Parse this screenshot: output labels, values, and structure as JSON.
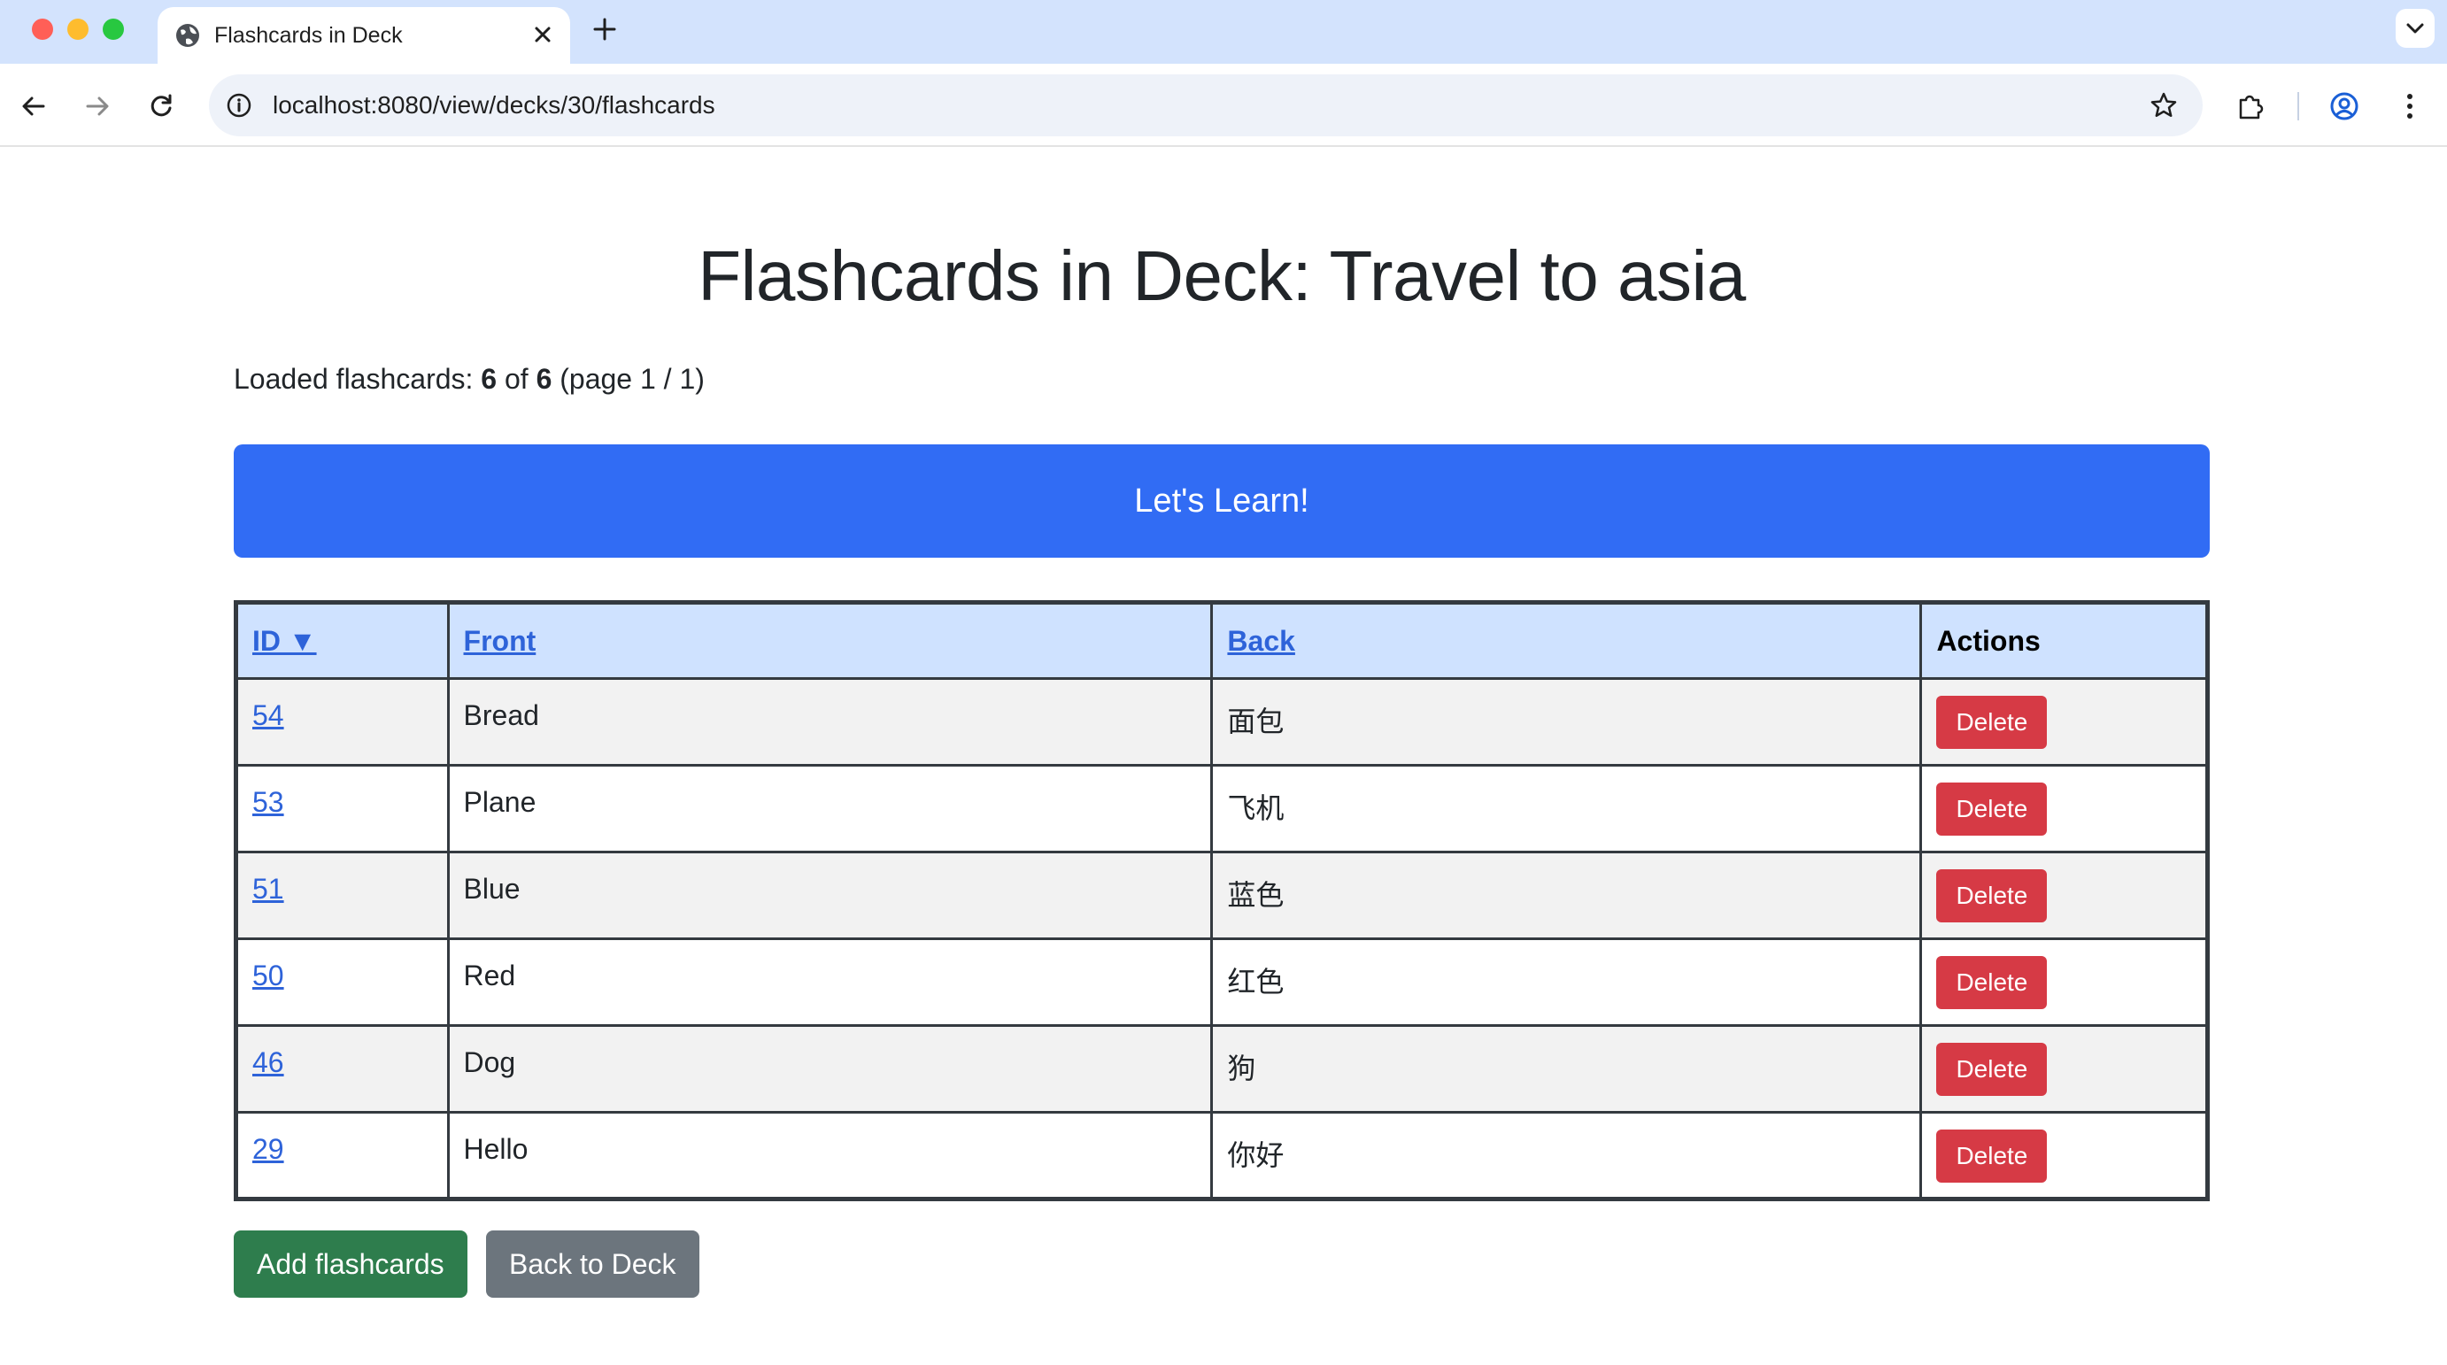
{
  "browser": {
    "tab_title": "Flashcards in Deck",
    "url": "localhost:8080/view/decks/30/flashcards"
  },
  "page": {
    "title": "Flashcards in Deck: Travel to asia",
    "loaded": {
      "prefix": "Loaded flashcards: ",
      "count": "6",
      "of_label": " of ",
      "total": "6",
      "page_info": " (page 1 / 1)"
    },
    "learn_button": "Let's Learn!",
    "table": {
      "headers": {
        "id": "ID ▼",
        "front": "Front",
        "back": "Back",
        "actions": "Actions"
      },
      "rows": [
        {
          "id": "54",
          "front": "Bread",
          "back": "面包",
          "action": "Delete"
        },
        {
          "id": "53",
          "front": "Plane",
          "back": "飞机",
          "action": "Delete"
        },
        {
          "id": "51",
          "front": "Blue",
          "back": "蓝色",
          "action": "Delete"
        },
        {
          "id": "50",
          "front": "Red",
          "back": "红色",
          "action": "Delete"
        },
        {
          "id": "46",
          "front": "Dog",
          "back": "狗",
          "action": "Delete"
        },
        {
          "id": "29",
          "front": "Hello",
          "back": "你好",
          "action": "Delete"
        }
      ]
    },
    "add_button": "Add flashcards",
    "back_button": "Back to Deck"
  },
  "colors": {
    "primary": "#316cf4",
    "danger": "#d63a45",
    "success": "#2e7d4d",
    "secondary": "#6c757d",
    "header_bg": "#cfe2ff",
    "link": "#2e63d9"
  },
  "icons": {
    "tab_favicon": "globe-icon",
    "tab_close": "close-icon",
    "new_tab": "plus-icon",
    "tab_menu": "chevron-down-icon",
    "back": "arrow-left-icon",
    "forward": "arrow-right-icon",
    "reload": "reload-icon",
    "site_info": "info-icon",
    "bookmark": "star-icon",
    "extensions": "puzzle-icon",
    "profile": "profile-icon",
    "menu": "kebab-menu-icon"
  }
}
